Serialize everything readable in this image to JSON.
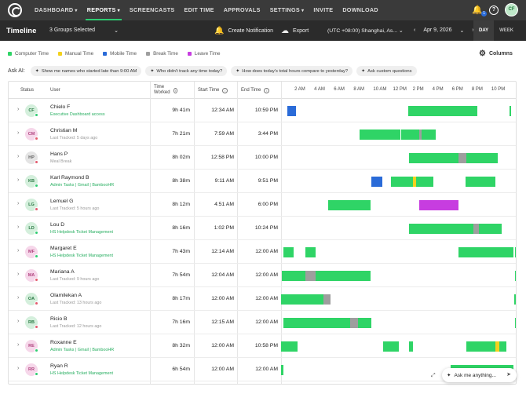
{
  "nav": {
    "items": [
      {
        "label": "DASHBOARD",
        "caret": true
      },
      {
        "label": "REPORTS",
        "caret": true,
        "active": true
      },
      {
        "label": "SCREENCASTS",
        "caret": false
      },
      {
        "label": "EDIT TIME",
        "caret": false
      },
      {
        "label": "APPROVALS",
        "caret": false
      },
      {
        "label": "SETTINGS",
        "caret": true
      },
      {
        "label": "INVITE",
        "caret": false
      },
      {
        "label": "DOWNLOAD",
        "caret": false
      }
    ],
    "notification_count": "1",
    "user_initials": "CF"
  },
  "subbar": {
    "title": "Timeline",
    "groups": "3 Groups Selected",
    "create_notification": "Create Notification",
    "export": "Export",
    "timezone": "(UTC +08:00) Shanghai, As...",
    "date": "Apr 9, 2026",
    "view_day": "DAY",
    "view_week": "WEEK"
  },
  "legend": [
    {
      "label": "Computer Time",
      "color": "#2fd466"
    },
    {
      "label": "Manual Time",
      "color": "#f3d11d"
    },
    {
      "label": "Mobile Time",
      "color": "#2a6bd8"
    },
    {
      "label": "Break Time",
      "color": "#9e9e9e"
    },
    {
      "label": "Leave Time",
      "color": "#c73de0"
    }
  ],
  "columns_label": "Columns",
  "ask_ai": {
    "label": "Ask AI:",
    "chips": [
      "Show me names who started late than 9:00 AM",
      "Who didn't track any time today?",
      "How does today's total hours compare to yesterday?",
      "Ask custom questions"
    ]
  },
  "table": {
    "headers": {
      "status": "Status",
      "user": "User",
      "time_worked": "Time Worked",
      "start_time": "Start Time",
      "end_time": "End Time"
    },
    "hours": [
      "2 AM",
      "4 AM",
      "6 AM",
      "8 AM",
      "10 AM",
      "12 PM",
      "2 PM",
      "4 PM",
      "6 PM",
      "8 PM",
      "10 PM"
    ],
    "rows": [
      {
        "initials": "CF",
        "avatar": "g",
        "online": true,
        "name": "Chielo F",
        "sub": "Executive Dashboard access",
        "sub_link": true,
        "worked": "9h 41m",
        "start": "12:34 AM",
        "end": "10:59 PM",
        "segments": [
          {
            "s": 0.6,
            "e": 1.5,
            "c": "b"
          },
          {
            "s": 12.9,
            "e": 19.9,
            "c": "g"
          },
          {
            "s": 23.2,
            "e": 23.4,
            "c": "g"
          }
        ]
      },
      {
        "initials": "CM",
        "avatar": "p",
        "online": false,
        "name": "Christian M",
        "sub": "Last Tracked: 5 days ago",
        "sub_link": false,
        "worked": "7h 21m",
        "start": "7:59 AM",
        "end": "3:44 PM",
        "segments": [
          {
            "s": 8.0,
            "e": 12.1,
            "c": "g"
          },
          {
            "s": 12.2,
            "e": 14.0,
            "c": "g"
          },
          {
            "s": 14.0,
            "e": 14.3,
            "c": "gr"
          },
          {
            "s": 14.3,
            "e": 15.7,
            "c": "g"
          }
        ]
      },
      {
        "initials": "HP",
        "avatar": "x",
        "online": false,
        "name": "Hans P",
        "sub": "Meal Break",
        "sub_link": false,
        "worked": "8h 02m",
        "start": "12:58 PM",
        "end": "10:00 PM",
        "segments": [
          {
            "s": 13.0,
            "e": 18.0,
            "c": "g"
          },
          {
            "s": 18.0,
            "e": 18.8,
            "c": "gr"
          },
          {
            "s": 18.8,
            "e": 22.0,
            "c": "g"
          }
        ]
      },
      {
        "initials": "KB",
        "avatar": "g",
        "online": true,
        "name": "Karl Raymond B",
        "sub": "Admin Tasks | Gmail | BambooHR",
        "sub_link": true,
        "worked": "8h 38m",
        "start": "9:11 AM",
        "end": "9:51 PM",
        "segments": [
          {
            "s": 9.2,
            "e": 10.3,
            "c": "b"
          },
          {
            "s": 11.2,
            "e": 13.4,
            "c": "g"
          },
          {
            "s": 13.4,
            "e": 13.7,
            "c": "y"
          },
          {
            "s": 13.7,
            "e": 15.5,
            "c": "g"
          },
          {
            "s": 18.7,
            "e": 21.8,
            "c": "g"
          }
        ]
      },
      {
        "initials": "LG",
        "avatar": "g",
        "online": false,
        "name": "Lemuel G",
        "sub": "Last Tracked: 5 hours ago",
        "sub_link": false,
        "worked": "8h 12m",
        "start": "4:51 AM",
        "end": "6:00 PM",
        "segments": [
          {
            "s": 4.8,
            "e": 9.1,
            "c": "g"
          },
          {
            "s": 14.0,
            "e": 18.0,
            "c": "m"
          }
        ]
      },
      {
        "initials": "LD",
        "avatar": "g",
        "online": true,
        "name": "Lou D",
        "sub": "HS Helpdesk Ticket Management",
        "sub_link": true,
        "worked": "8h 16m",
        "start": "1:02 PM",
        "end": "10:24 PM",
        "segments": [
          {
            "s": 13.0,
            "e": 19.5,
            "c": "g"
          },
          {
            "s": 19.5,
            "e": 20.1,
            "c": "gr"
          },
          {
            "s": 20.1,
            "e": 22.4,
            "c": "g"
          }
        ]
      },
      {
        "initials": "MF",
        "avatar": "p",
        "online": true,
        "name": "Margaret E",
        "sub": "HS Helpdesk Ticket Management",
        "sub_link": true,
        "worked": "7h 43m",
        "start": "12:14 AM",
        "end": "12:00 AM",
        "segments": [
          {
            "s": 0.2,
            "e": 1.3,
            "c": "g"
          },
          {
            "s": 2.5,
            "e": 3.5,
            "c": "g"
          },
          {
            "s": 18.0,
            "e": 23.6,
            "c": "g"
          },
          {
            "s": 23.8,
            "e": 24.0,
            "c": "g"
          }
        ]
      },
      {
        "initials": "MA",
        "avatar": "p",
        "online": false,
        "name": "Mariana A",
        "sub": "Last Tracked: 9 hours ago",
        "sub_link": false,
        "worked": "7h 54m",
        "start": "12:04 AM",
        "end": "12:00 AM",
        "segments": [
          {
            "s": 0.1,
            "e": 2.5,
            "c": "g"
          },
          {
            "s": 2.5,
            "e": 3.5,
            "c": "gr"
          },
          {
            "s": 3.5,
            "e": 9.1,
            "c": "g"
          },
          {
            "s": 23.8,
            "e": 24.0,
            "c": "g"
          }
        ]
      },
      {
        "initials": "OA",
        "avatar": "g",
        "online": false,
        "name": "Olamilekan A",
        "sub": "Last Tracked: 13 hours ago",
        "sub_link": false,
        "worked": "8h 17m",
        "start": "12:00 AM",
        "end": "12:00 AM",
        "segments": [
          {
            "s": 0.0,
            "e": 4.3,
            "c": "g"
          },
          {
            "s": 4.3,
            "e": 5.0,
            "c": "gr"
          },
          {
            "s": 23.7,
            "e": 24.0,
            "c": "g"
          }
        ]
      },
      {
        "initials": "RB",
        "avatar": "g",
        "online": false,
        "name": "Ricio B",
        "sub": "Last Tracked: 12 hours ago",
        "sub_link": false,
        "worked": "7h 16m",
        "start": "12:15 AM",
        "end": "12:00 AM",
        "segments": [
          {
            "s": 0.2,
            "e": 7.0,
            "c": "g"
          },
          {
            "s": 7.0,
            "e": 7.8,
            "c": "gr"
          },
          {
            "s": 7.8,
            "e": 9.2,
            "c": "g"
          },
          {
            "s": 23.8,
            "e": 24.0,
            "c": "g"
          }
        ]
      },
      {
        "initials": "RE",
        "avatar": "p",
        "online": true,
        "name": "Roxanne E",
        "sub": "Admin Tasks | Gmail | BambooHR",
        "sub_link": true,
        "worked": "8h 32m",
        "start": "12:00 AM",
        "end": "10:58 PM",
        "segments": [
          {
            "s": 0.0,
            "e": 1.7,
            "c": "g"
          },
          {
            "s": 10.4,
            "e": 12.0,
            "c": "g"
          },
          {
            "s": 13.0,
            "e": 13.4,
            "c": "g"
          },
          {
            "s": 18.8,
            "e": 21.8,
            "c": "g"
          },
          {
            "s": 21.8,
            "e": 22.2,
            "c": "y"
          },
          {
            "s": 22.2,
            "e": 22.9,
            "c": "g"
          }
        ]
      },
      {
        "initials": "RR",
        "avatar": "p",
        "online": true,
        "name": "Ryan R",
        "sub": "HS Helpdesk Ticket Management",
        "sub_link": true,
        "worked": "6h 54m",
        "start": "12:00 AM",
        "end": "12:00 AM",
        "segments": [
          {
            "s": 0.0,
            "e": 0.2,
            "c": "g"
          },
          {
            "s": 17.2,
            "e": 23.6,
            "c": "g"
          }
        ]
      }
    ]
  },
  "ask_me": "Ask me anything..."
}
